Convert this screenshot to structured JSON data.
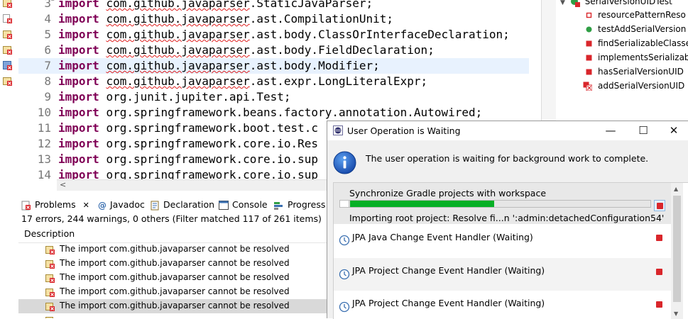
{
  "editor": {
    "lines": [
      {
        "num": "3",
        "fold": "⊖",
        "kw": "import",
        "pkg": "com.github.javaparser",
        "rest": ".StaticJavaParser;",
        "marker": "error-folded"
      },
      {
        "num": "4",
        "kw": "import",
        "pkg": "com.github.javaparser",
        "rest": ".ast.CompilationUnit;",
        "marker": "error"
      },
      {
        "num": "5",
        "kw": "import",
        "pkg": "com.github.javaparser",
        "rest": ".ast.body.ClassOrInterfaceDeclaration;",
        "marker": "error-folded"
      },
      {
        "num": "6",
        "kw": "import",
        "pkg": "com.github.javaparser",
        "rest": ".ast.body.FieldDeclaration;",
        "marker": "error-folded"
      },
      {
        "num": "7",
        "kw": "import",
        "pkg": "com.github.javaparser",
        "rest": ".ast.body.Modifier;",
        "marker": "error-blue",
        "highlighted": true
      },
      {
        "num": "8",
        "kw": "import",
        "pkg": "com.github.javaparser",
        "rest": ".ast.expr.LongLiteralExpr;",
        "marker": "error-folded"
      },
      {
        "num": "9",
        "kw": "import",
        "pkg": "",
        "rest": "org.junit.jupiter.api.Test;"
      },
      {
        "num": "10",
        "kw": "import",
        "pkg": "",
        "rest": "org.springframework.beans.factory.annotation.Autowired;"
      },
      {
        "num": "11",
        "kw": "import",
        "pkg": "",
        "rest": "org.springframework.boot.test.c"
      },
      {
        "num": "12",
        "kw": "import",
        "pkg": "",
        "rest": "org.springframework.core.io.Res"
      },
      {
        "num": "13",
        "kw": "import",
        "pkg": "",
        "rest": "org.springframework.core.io.sup"
      },
      {
        "num": "14",
        "kw": "import",
        "pkg": "",
        "rest": "org.springframework.core.io.sup"
      }
    ],
    "scroll_left_arrow": "<"
  },
  "outline": {
    "root": "SerialVersionUIDTest",
    "items": [
      {
        "label": "resourcePatternReso",
        "icon": "field-private"
      },
      {
        "label": "testAddSerialVersion",
        "icon": "method-public"
      },
      {
        "label": "findSerializableClasse",
        "icon": "method-private"
      },
      {
        "label": "implementsSerializab",
        "icon": "method-private"
      },
      {
        "label": "hasSerialVersionUID",
        "icon": "method-private"
      },
      {
        "label": "addSerialVersionUID",
        "icon": "method-error"
      }
    ]
  },
  "views": {
    "tabs": [
      {
        "label": "Problems",
        "icon": "problems-icon",
        "closable": "✕",
        "active": true
      },
      {
        "label": "Javadoc",
        "icon": "at-icon"
      },
      {
        "label": "Declaration",
        "icon": "declaration-icon"
      },
      {
        "label": "Console",
        "icon": "console-icon"
      },
      {
        "label": "Progress",
        "icon": "progress-icon"
      }
    ],
    "problems_summary": "17 errors, 244 warnings, 0 others (Filter matched 117 of 261 items)",
    "column_description": "Description",
    "rows": [
      {
        "text": "The import com.github.javaparser cannot be resolved"
      },
      {
        "text": "The import com.github.javaparser cannot be resolved"
      },
      {
        "text": "The import com.github.javaparser cannot be resolved"
      },
      {
        "text": "The import com.github.javaparser cannot be resolved"
      },
      {
        "text": "The import com.github.javaparser cannot be resolved",
        "selected": true
      }
    ]
  },
  "dialog": {
    "title": "User Operation is Waiting",
    "minimize": "—",
    "maximize": "☐",
    "close": "✕",
    "message": "The user operation is waiting for background work to complete.",
    "jobs": [
      {
        "name": "Synchronize Gradle projects with workspace",
        "subtask": "Importing root project: Resolve fi...n ':admin:detachedConfiguration54'",
        "progress": 0.48,
        "running": true
      },
      {
        "name": "JPA Java Change Event Handler (Waiting)"
      },
      {
        "name": "JPA Project Change Event Handler (Waiting)"
      },
      {
        "name": "JPA Project Change Event Handler (Waiting)"
      }
    ]
  },
  "colors": {
    "keyword": "#7f0055",
    "error_red": "#d9262b",
    "progress_green": "#06b025",
    "info_blue": "#1a64c8",
    "line_highlight": "#e8f2fe"
  }
}
